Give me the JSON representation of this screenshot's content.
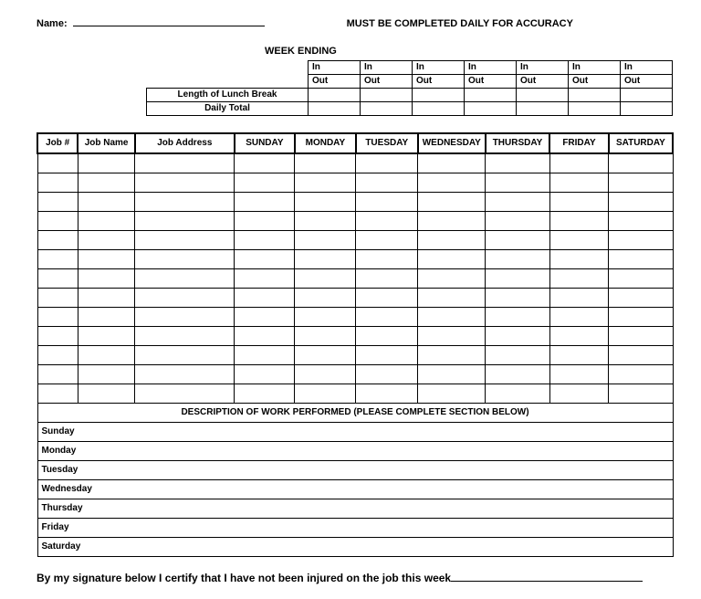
{
  "header": {
    "name_label": "Name:",
    "must_complete": "MUST BE COMPLETED DAILY FOR ACCURACY",
    "week_ending": "WEEK ENDING"
  },
  "time_table": {
    "in": "In",
    "out": "Out",
    "lunch_label": "Length of Lunch Break",
    "daily_total_label": "Daily Total"
  },
  "job_table": {
    "headers": {
      "jobnum": "Job #",
      "jobname": "Job Name",
      "jobaddr": "Job Address",
      "days": [
        "SUNDAY",
        "MONDAY",
        "TUESDAY",
        "WEDNESDAY",
        "THURSDAY",
        "FRIDAY",
        "SATURDAY"
      ]
    },
    "section_title": "DESCRIPTION OF WORK PERFORMED (PLEASE COMPLETE SECTION BELOW)",
    "desc_days": [
      "Sunday",
      "Monday",
      "Tuesday",
      "Wednesday",
      "Thursday",
      "Friday",
      "Saturday"
    ]
  },
  "certify": "By my signature below I certify that I have not been injured on the job this week"
}
